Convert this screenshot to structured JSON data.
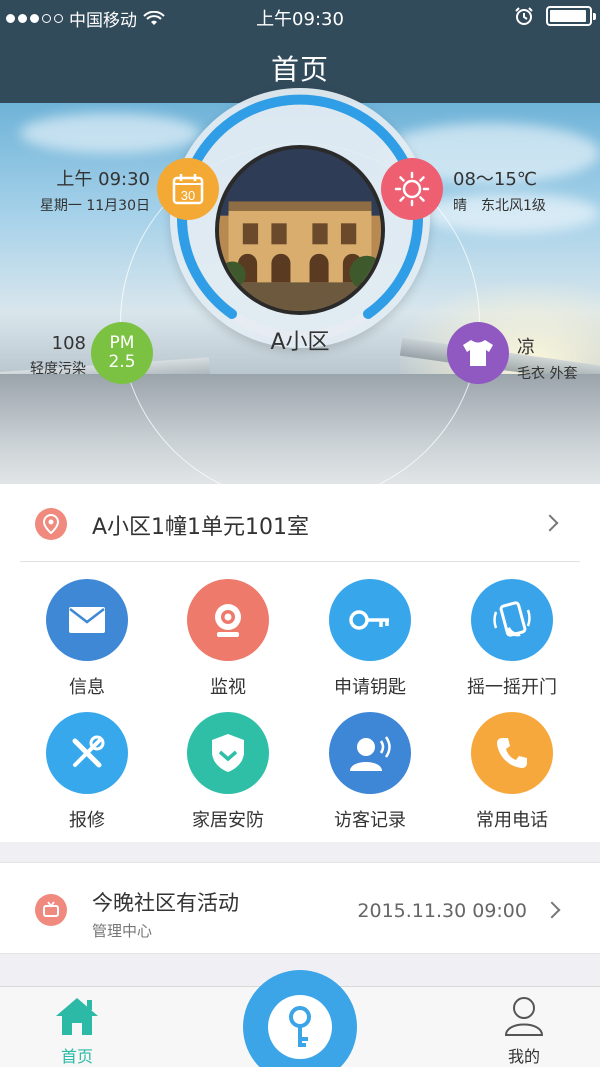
{
  "status_bar": {
    "carrier": "中国移动",
    "time": "上午09:30",
    "signal_bars_filled": 3,
    "signal_bars_total": 5,
    "battery_level": 0.95,
    "icons": [
      "wifi-icon",
      "alarm-icon",
      "battery-icon"
    ]
  },
  "nav": {
    "title": "首页"
  },
  "hero": {
    "time": "上午 09:30",
    "date": "星期一 11月30日",
    "calendar_day": "30",
    "temperature": "08～15℃",
    "weather": "晴　东北风1级",
    "aqi": "108",
    "aqi_level": "轻度污染",
    "pm_label": "PM",
    "pm_value": "2.5",
    "clothing": "凉",
    "clothing_tip": "毛衣 外套",
    "community": "A小区",
    "colors": {
      "calendar": "#f5a935",
      "weather": "#ee5f71",
      "pm": "#7cc242",
      "clothing": "#9058c1",
      "ring": "#2f9ee6"
    }
  },
  "address": {
    "text": "A小区1幢1单元101室"
  },
  "grid": [
    {
      "label": "信息",
      "icon": "mail-icon",
      "color": "#3f88d6"
    },
    {
      "label": "监视",
      "icon": "camera-icon",
      "color": "#ee7a6b"
    },
    {
      "label": "申请钥匙",
      "icon": "key-icon",
      "color": "#37a6eb"
    },
    {
      "label": "摇一摇开门",
      "icon": "shake-phone-icon",
      "color": "#3aa4ea"
    },
    {
      "label": "报修",
      "icon": "tools-icon",
      "color": "#38a8ec"
    },
    {
      "label": "家居安防",
      "icon": "shield-icon",
      "color": "#2fbfa6"
    },
    {
      "label": "访客记录",
      "icon": "visitor-icon",
      "color": "#3e86d6"
    },
    {
      "label": "常用电话",
      "icon": "phone-icon",
      "color": "#f7a83d"
    }
  ],
  "event": {
    "title": "今晚社区有活动",
    "source": "管理中心",
    "datetime": "2015.11.30  09:00"
  },
  "tabbar": {
    "home": "首页",
    "mine": "我的",
    "active_color": "#2cb9a6"
  }
}
